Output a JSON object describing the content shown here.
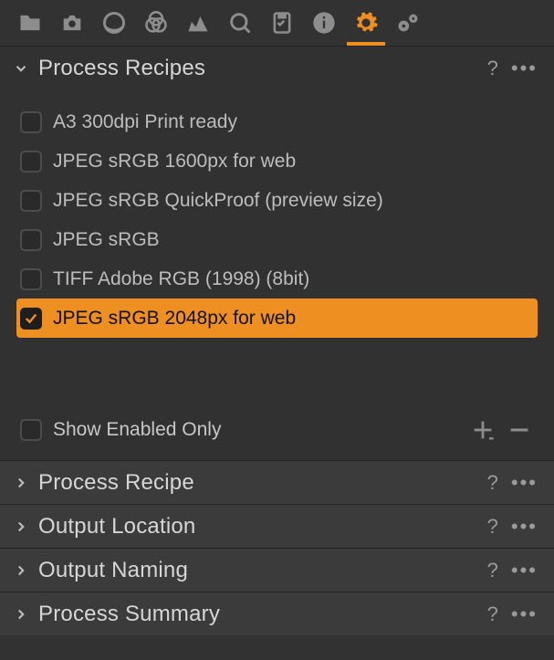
{
  "colors": {
    "accent": "#ee8f22"
  },
  "toolbar": {
    "icons": [
      "folder",
      "camera",
      "circle",
      "rings",
      "histogram",
      "loupe",
      "checklist",
      "info",
      "gear",
      "gears"
    ],
    "active_index": 8
  },
  "panels": {
    "recipes": {
      "title": "Process Recipes",
      "help": "?",
      "more": "•••",
      "items": [
        {
          "label": "A3 300dpi Print ready",
          "checked": false,
          "selected": false
        },
        {
          "label": "JPEG sRGB 1600px for web",
          "checked": false,
          "selected": false
        },
        {
          "label": "JPEG sRGB QuickProof (preview size)",
          "checked": false,
          "selected": false
        },
        {
          "label": "JPEG sRGB",
          "checked": false,
          "selected": false
        },
        {
          "label": "TIFF Adobe RGB (1998) (8bit)",
          "checked": false,
          "selected": false
        },
        {
          "label": "JPEG sRGB 2048px for web",
          "checked": true,
          "selected": true
        }
      ],
      "show_enabled_only": {
        "label": "Show Enabled Only",
        "checked": false
      },
      "add_label": "Add recipe",
      "remove_label": "Remove recipe"
    },
    "collapsed": [
      {
        "title": "Process Recipe",
        "help": "?",
        "more": "•••"
      },
      {
        "title": "Output Location",
        "help": "?",
        "more": "•••"
      },
      {
        "title": "Output Naming",
        "help": "?",
        "more": "•••"
      },
      {
        "title": "Process Summary",
        "help": "?",
        "more": "•••"
      }
    ]
  }
}
